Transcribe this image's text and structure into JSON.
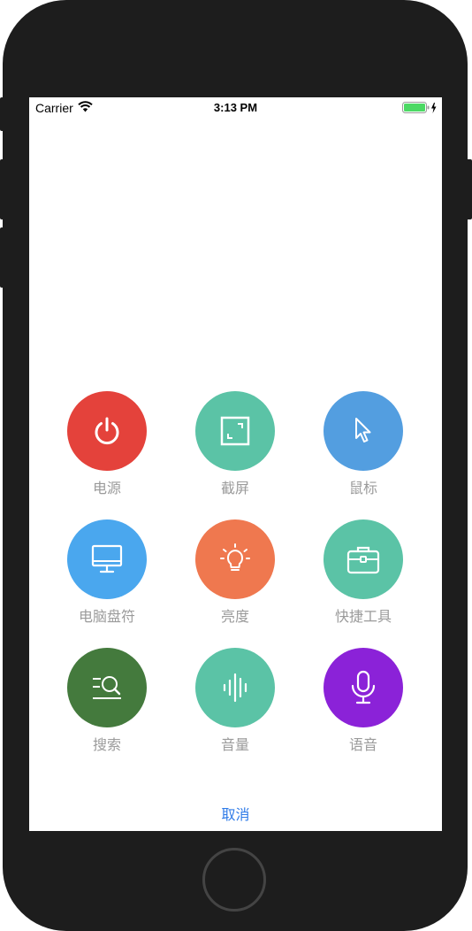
{
  "status_bar": {
    "carrier": "Carrier",
    "time": "3:13 PM"
  },
  "menu": {
    "items": [
      {
        "label": "电源",
        "color": "#e4423b",
        "icon": "power-icon"
      },
      {
        "label": "截屏",
        "color": "#5bc3a6",
        "icon": "screenshot-icon"
      },
      {
        "label": "鼠标",
        "color": "#539ee0",
        "icon": "cursor-icon"
      },
      {
        "label": "电脑盘符",
        "color": "#4aa7ee",
        "icon": "monitor-icon"
      },
      {
        "label": "亮度",
        "color": "#ef784f",
        "icon": "lightbulb-icon"
      },
      {
        "label": "快捷工具",
        "color": "#5bc3a6",
        "icon": "toolbox-icon"
      },
      {
        "label": "搜索",
        "color": "#447a3d",
        "icon": "search-icon"
      },
      {
        "label": "音量",
        "color": "#5bc3a6",
        "icon": "volume-icon"
      },
      {
        "label": "语音",
        "color": "#8b22d8",
        "icon": "microphone-icon"
      }
    ],
    "cancel_label": "取消"
  }
}
